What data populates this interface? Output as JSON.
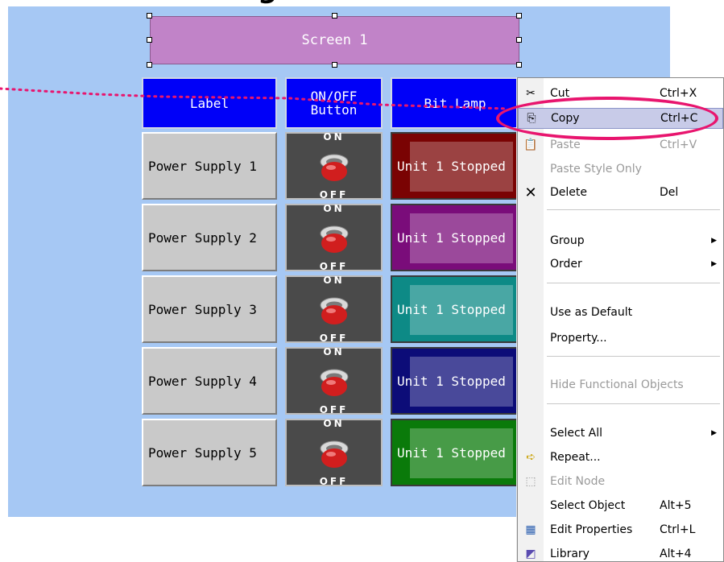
{
  "screen": {
    "title": "Screen 1"
  },
  "headers": {
    "label": "Label",
    "onoff": "ON/OFF\nButton",
    "bitlamp": "Bit Lamp"
  },
  "rows": [
    {
      "label": "Power Supply 1",
      "on": "ON",
      "off": "OFF",
      "lamp": "Unit 1 Stopped",
      "lamp_color": "#7a0303"
    },
    {
      "label": "Power Supply 2",
      "on": "ON",
      "off": "OFF",
      "lamp": "Unit 1 Stopped",
      "lamp_color": "#7a0c7a"
    },
    {
      "label": "Power Supply 3",
      "on": "ON",
      "off": "OFF",
      "lamp": "Unit 1 Stopped",
      "lamp_color": "#0d8a86"
    },
    {
      "label": "Power Supply 4",
      "on": "ON",
      "off": "OFF",
      "lamp": "Unit 1 Stopped",
      "lamp_color": "#0c0c78"
    },
    {
      "label": "Power Supply 5",
      "on": "ON",
      "off": "OFF",
      "lamp": "Unit 1 Stopped",
      "lamp_color": "#0a7a0a"
    }
  ],
  "menu": {
    "cut": {
      "label": "Cut",
      "shortcut": "Ctrl+X",
      "icon": "scissors-icon"
    },
    "copy": {
      "label": "Copy",
      "shortcut": "Ctrl+C",
      "icon": "copy-icon"
    },
    "paste": {
      "label": "Paste",
      "shortcut": "Ctrl+V",
      "icon": "paste-icon"
    },
    "paste_style": {
      "label": "Paste Style Only"
    },
    "delete": {
      "label": "Delete",
      "shortcut": "Del",
      "icon": "delete-icon"
    },
    "group": {
      "label": "Group"
    },
    "order": {
      "label": "Order"
    },
    "use_default": {
      "label": "Use as Default"
    },
    "property": {
      "label": "Property..."
    },
    "hide_functional": {
      "label": "Hide Functional Objects"
    },
    "select_all": {
      "label": "Select All"
    },
    "repeat": {
      "label": "Repeat...",
      "icon": "repeat-icon"
    },
    "edit_node": {
      "label": "Edit Node",
      "icon": "edit-node-icon"
    },
    "select_object": {
      "label": "Select Object",
      "shortcut": "Alt+5"
    },
    "edit_properties": {
      "label": "Edit Properties",
      "shortcut": "Ctrl+L",
      "icon": "edit-properties-icon"
    },
    "library": {
      "label": "Library",
      "shortcut": "Alt+4",
      "icon": "library-icon"
    }
  },
  "colors": {
    "canvas": "#a6c8f4",
    "header_blue": "#0000f8",
    "screen_button": "#c183c8",
    "highlight_ring": "#e8156e",
    "dotted_line": "#e8156e"
  }
}
